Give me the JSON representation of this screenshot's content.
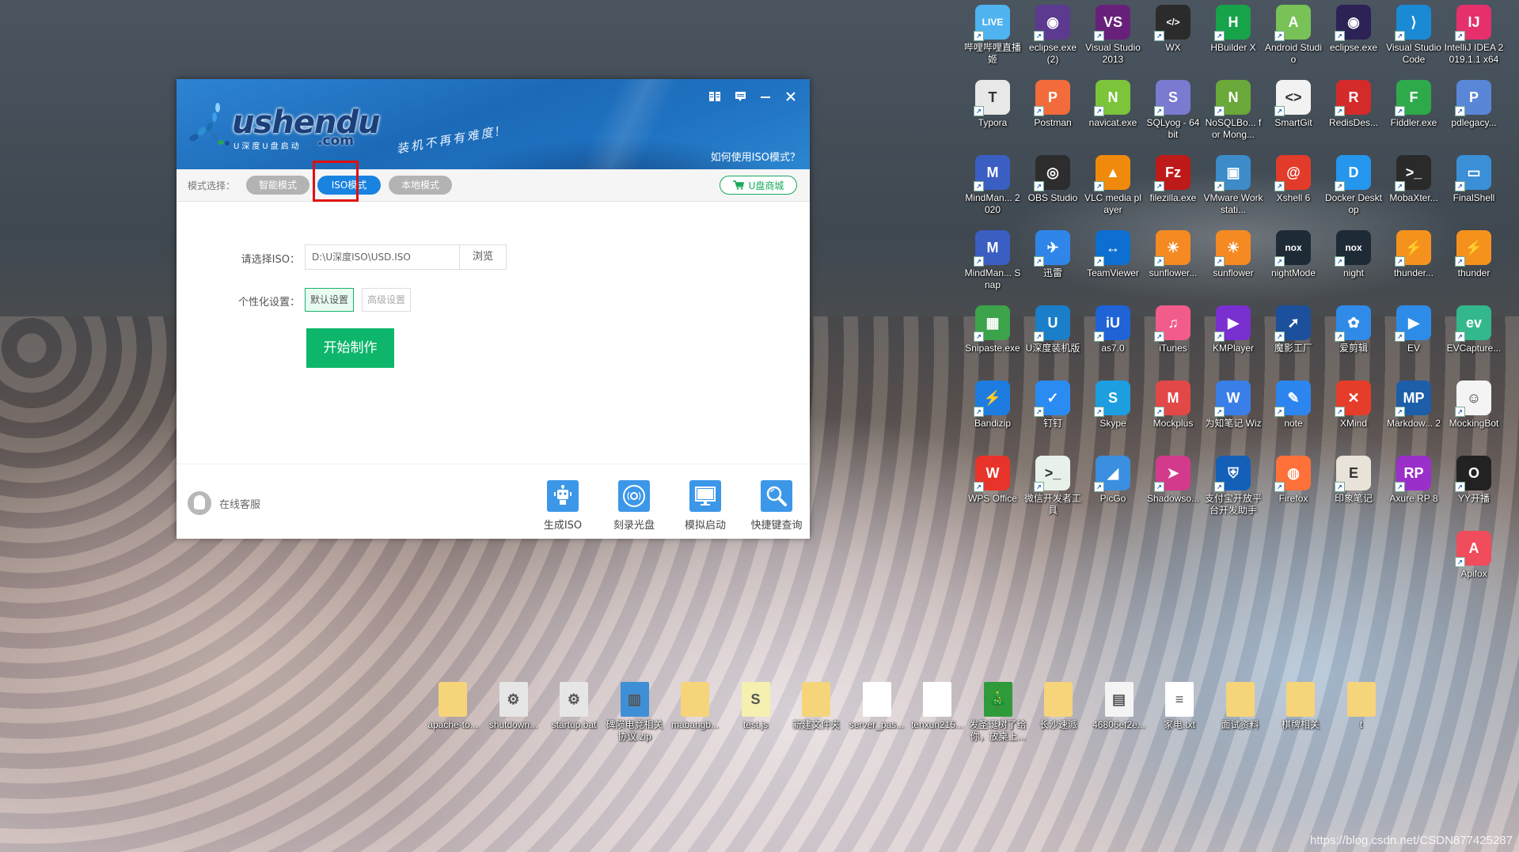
{
  "window": {
    "brand": "ushendu",
    "brand_sub": "U深度U盘启动",
    "brand_com": ".com",
    "slogan": "装机不再有难度!",
    "help_link": "如何使用ISO模式？",
    "titlebar_icons": [
      "book-icon",
      "feedback-icon",
      "minimize-icon",
      "close-icon"
    ],
    "mode_bar": {
      "label": "模式选择：",
      "modes": [
        {
          "label": "智能模式",
          "active": false
        },
        {
          "label": "ISO模式",
          "active": true
        },
        {
          "label": "本地模式",
          "active": false
        }
      ],
      "shop_label": "U盘商城"
    },
    "form": {
      "iso_label": "请选择ISO：",
      "iso_value": "D:\\U深度ISO\\USD.ISO",
      "browse_label": "浏览",
      "custom_label": "个性化设置：",
      "default_setting": "默认设置",
      "advanced_setting": "高级设置",
      "start_label": "开始制作"
    },
    "footer": {
      "service_label": "在线客服",
      "tools": [
        {
          "label": "生成ISO",
          "icon": "robot-icon"
        },
        {
          "label": "刻录光盘",
          "icon": "disc-icon"
        },
        {
          "label": "模拟启动",
          "icon": "monitor-icon"
        },
        {
          "label": "快捷键查询",
          "icon": "search-icon"
        }
      ]
    },
    "highlight_color": "#e01010",
    "accent_color": "#1a83e0",
    "green_color": "#0db66a"
  },
  "desktop": {
    "icons": [
      {
        "label": "哔哩哔哩直播姬",
        "color": "#4fb3ef",
        "glyph": "LIVE"
      },
      {
        "label": "eclipse.exe (2)",
        "color": "#5b3a8f",
        "glyph": "◉"
      },
      {
        "label": "Visual Studio 2013",
        "color": "#68217a",
        "glyph": "VS"
      },
      {
        "label": "WX",
        "color": "#2b2b2b",
        "glyph": "</>"
      },
      {
        "label": "HBuilder X",
        "color": "#16a34a",
        "glyph": "H"
      },
      {
        "label": "Android Studio",
        "color": "#78c257",
        "glyph": "A"
      },
      {
        "label": "eclipse.exe",
        "color": "#2c2255",
        "glyph": "◉"
      },
      {
        "label": "Visual Studio Code",
        "color": "#1a8ad4",
        "glyph": "⟩"
      },
      {
        "label": "IntelliJ IDEA 2019.1.1 x64",
        "color": "#e5306c",
        "glyph": "IJ"
      },
      {
        "label": "Typora",
        "color": "#e8e8e8",
        "glyph": "T"
      },
      {
        "label": "Postman",
        "color": "#f26b3a",
        "glyph": "P"
      },
      {
        "label": "navicat.exe",
        "color": "#7cc53b",
        "glyph": "N"
      },
      {
        "label": "SQLyog - 64 bit",
        "color": "#7a7ad0",
        "glyph": "S"
      },
      {
        "label": "NoSQLBo... for Mong...",
        "color": "#6aa83a",
        "glyph": "N"
      },
      {
        "label": "SmartGit",
        "color": "#f2f2f2",
        "glyph": "<>"
      },
      {
        "label": "RedisDes...",
        "color": "#d42a2a",
        "glyph": "R"
      },
      {
        "label": "Fiddler.exe",
        "color": "#2faa4a",
        "glyph": "F"
      },
      {
        "label": "pdlegacy...",
        "color": "#5a86d8",
        "glyph": "P"
      },
      {
        "label": "MindMan... 2020",
        "color": "#3b5ec2",
        "glyph": "M"
      },
      {
        "label": "OBS Studio",
        "color": "#2d2d2d",
        "glyph": "◎"
      },
      {
        "label": "VLC media player",
        "color": "#f08a0c",
        "glyph": "▲"
      },
      {
        "label": "filezilla.exe",
        "color": "#bf1a1a",
        "glyph": "Fz"
      },
      {
        "label": "VMware Workstati...",
        "color": "#3d8bc9",
        "glyph": "▣"
      },
      {
        "label": "Xshell 6",
        "color": "#e23b2a",
        "glyph": "@"
      },
      {
        "label": "Docker Desktop",
        "color": "#2496ed",
        "glyph": "D"
      },
      {
        "label": "MobaXter...",
        "color": "#2a2a2a",
        "glyph": ">_"
      },
      {
        "label": "FinalShell",
        "color": "#3a8fd6",
        "glyph": "▭"
      },
      {
        "label": "MindMan... Snap",
        "color": "#3b5ec2",
        "glyph": "M"
      },
      {
        "label": "迅雷",
        "color": "#2f86e8",
        "glyph": "✈"
      },
      {
        "label": "TeamViewer",
        "color": "#0e6fd2",
        "glyph": "↔"
      },
      {
        "label": "sunflower...",
        "color": "#f58a23",
        "glyph": "☀"
      },
      {
        "label": "sunflower",
        "color": "#f58a23",
        "glyph": "☀"
      },
      {
        "label": "nightMode",
        "color": "#1e2a35",
        "glyph": "nox"
      },
      {
        "label": "night",
        "color": "#1e2a35",
        "glyph": "nox"
      },
      {
        "label": "thunder...",
        "color": "#f5921e",
        "glyph": "⚡"
      },
      {
        "label": "thunder",
        "color": "#f5921e",
        "glyph": "⚡"
      },
      {
        "label": "Snipaste.exe",
        "color": "#3ca34a",
        "glyph": "▦"
      },
      {
        "label": "U深度装机版",
        "color": "#1a7ec9",
        "glyph": "U"
      },
      {
        "label": "as7.0",
        "color": "#1f63d6",
        "glyph": "iU"
      },
      {
        "label": "iTunes",
        "color": "#f25c8a",
        "glyph": "♫"
      },
      {
        "label": "KMPlayer",
        "color": "#7a2fd0",
        "glyph": "▶"
      },
      {
        "label": "魔影工厂",
        "color": "#1c4f9c",
        "glyph": "➚"
      },
      {
        "label": "爱剪辑",
        "color": "#2f8ae8",
        "glyph": "✿"
      },
      {
        "label": "EV",
        "color": "#2d8ce8",
        "glyph": "▶"
      },
      {
        "label": "EVCapture...",
        "color": "#32b88c",
        "glyph": "ev"
      },
      {
        "label": "Bandizip",
        "color": "#1e7ce0",
        "glyph": "⚡"
      },
      {
        "label": "钉钉",
        "color": "#2a8bf2",
        "glyph": "✓"
      },
      {
        "label": "Skype",
        "color": "#1c9ee0",
        "glyph": "S"
      },
      {
        "label": "Mockplus",
        "color": "#e24848",
        "glyph": "M"
      },
      {
        "label": "为知笔记 Wiz",
        "color": "#3a7ee8",
        "glyph": "W"
      },
      {
        "label": "note",
        "color": "#2d86f0",
        "glyph": "✎"
      },
      {
        "label": "XMind",
        "color": "#e53d2a",
        "glyph": "✕"
      },
      {
        "label": "Markdow... 2",
        "color": "#1c5ea8",
        "glyph": "MP"
      },
      {
        "label": "MockingBot",
        "color": "#f4f4f4",
        "glyph": "☺"
      },
      {
        "label": "WPS Office",
        "color": "#e8332a",
        "glyph": "W"
      },
      {
        "label": "微信开发者工具",
        "color": "#e8f0ea",
        "glyph": ">_"
      },
      {
        "label": "PicGo",
        "color": "#3b8fe0",
        "glyph": "◢"
      },
      {
        "label": "Shadowso...",
        "color": "#d33a8c",
        "glyph": "➤"
      },
      {
        "label": "支付宝开放平台开发助手",
        "color": "#1460b8",
        "glyph": "⛨"
      },
      {
        "label": "Firefox",
        "color": "#ff7139",
        "glyph": "◍"
      },
      {
        "label": "印象笔记",
        "color": "#e8e2d8",
        "glyph": "E"
      },
      {
        "label": "Axure RP 8",
        "color": "#9b2fc9",
        "glyph": "RP"
      },
      {
        "label": "YY开播",
        "color": "#222222",
        "glyph": "O"
      },
      {
        "label": "Apifox",
        "color": "#f04c5c",
        "glyph": "A"
      }
    ],
    "files": [
      {
        "label": "apache-to...",
        "type": "folder"
      },
      {
        "label": "shutdown...",
        "type": "bat"
      },
      {
        "label": "startup.bat",
        "type": "bat"
      },
      {
        "label": "碑陨电竞相关协议.zip",
        "type": "zip"
      },
      {
        "label": "mabangb...",
        "type": "folder"
      },
      {
        "label": "test.js",
        "type": "js"
      },
      {
        "label": "新建文件夹",
        "type": "folder"
      },
      {
        "label": "server_pas...",
        "type": "file"
      },
      {
        "label": "tenxun215...",
        "type": "file"
      },
      {
        "label": "发圣诞树了给你，放桌上...",
        "type": "tree"
      },
      {
        "label": "长沙速派",
        "type": "folder"
      },
      {
        "label": "46806ef2e...",
        "type": "doc"
      },
      {
        "label": "家电.txt",
        "type": "txt"
      },
      {
        "label": "面试资料",
        "type": "folder"
      },
      {
        "label": "棋牌相关",
        "type": "folder"
      },
      {
        "label": "t",
        "type": "folder"
      }
    ]
  },
  "watermark": "https://blog.csdn.net/CSDN877425287"
}
